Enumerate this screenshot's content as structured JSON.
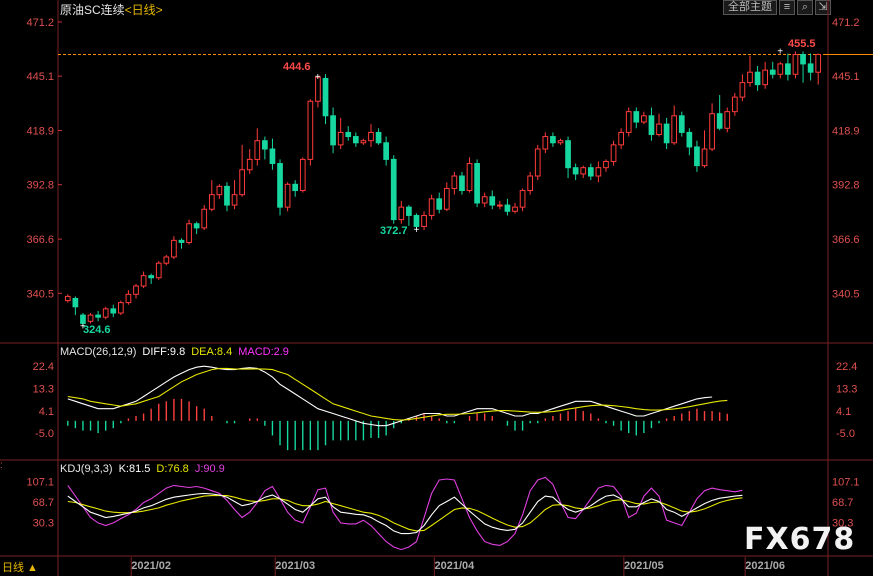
{
  "title": {
    "name": "原油SC连续",
    "period": "<日线>"
  },
  "toolbar": {
    "dropdown_label": "全部主题",
    "icons": [
      "list-icon",
      "search-icon",
      "expand-icon"
    ]
  },
  "colors": {
    "up": "#ff3b3b",
    "down": "#17d7a0",
    "dif": "#ffffff",
    "dea": "#e6e600",
    "macd_label": "#ff33ff",
    "k": "#ffffff",
    "d": "#e6e600",
    "j": "#e040e0",
    "axis": "#c8323c",
    "date_axis": "#aaaaaa"
  },
  "chart_data": [
    {
      "type": "candlestick",
      "title": "原油SC连续",
      "period": "日线",
      "price_ticks": [
        "471.2",
        "445.1",
        "418.9",
        "392.8",
        "366.6",
        "340.5"
      ],
      "ylim": [
        318,
        476
      ],
      "date_ticks": [
        "2021/02",
        "2021/03",
        "2021/04",
        "2021/05",
        "2021/06"
      ],
      "annotations": {
        "high_label": "444.6",
        "low_label": "324.6",
        "mid_low_label": "372.7",
        "last_label": "455.5"
      },
      "last_price": 455.5,
      "candles": [
        [
          337,
          339,
          336,
          340
        ],
        [
          338,
          334,
          330,
          339
        ],
        [
          330,
          326,
          324.6,
          331
        ],
        [
          327,
          330,
          326,
          331
        ],
        [
          330,
          329,
          327,
          332
        ],
        [
          329,
          333,
          328,
          334
        ],
        [
          333,
          331,
          329,
          335
        ],
        [
          331,
          336,
          330,
          337
        ],
        [
          336,
          340,
          335,
          342
        ],
        [
          340,
          344,
          338,
          345
        ],
        [
          344,
          349,
          343,
          351
        ],
        [
          349,
          348,
          345,
          350
        ],
        [
          348,
          355,
          347,
          356
        ],
        [
          355,
          358,
          354,
          359
        ],
        [
          358,
          366,
          357,
          368
        ],
        [
          366,
          365,
          362,
          367
        ],
        [
          365,
          374,
          364,
          376
        ],
        [
          374,
          372,
          369,
          375
        ],
        [
          372,
          381,
          371,
          383
        ],
        [
          381,
          388,
          380,
          395
        ],
        [
          388,
          392,
          386,
          393
        ],
        [
          392,
          383,
          380,
          394
        ],
        [
          383,
          388,
          381,
          395
        ],
        [
          388,
          400,
          387,
          412
        ],
        [
          400,
          405,
          398,
          410
        ],
        [
          405,
          414,
          402,
          420
        ],
        [
          414,
          410,
          405,
          416
        ],
        [
          410,
          403,
          400,
          415
        ],
        [
          403,
          382,
          378,
          405
        ],
        [
          382,
          393,
          380,
          394
        ],
        [
          393,
          390,
          387,
          395
        ],
        [
          390,
          405,
          389,
          406
        ],
        [
          405,
          433,
          402,
          434
        ],
        [
          433,
          444.6,
          430,
          444.6
        ],
        [
          444,
          426,
          422,
          446
        ],
        [
          426,
          412,
          408,
          430
        ],
        [
          412,
          418,
          410,
          425
        ],
        [
          418,
          416,
          414,
          421
        ],
        [
          416,
          413,
          411,
          418
        ],
        [
          413,
          414,
          412,
          415
        ],
        [
          414,
          418,
          411,
          422
        ],
        [
          418,
          413,
          412,
          420
        ],
        [
          413,
          405,
          402,
          416
        ],
        [
          405,
          376,
          374,
          407
        ],
        [
          376,
          382,
          374,
          385
        ],
        [
          382,
          378,
          373,
          383
        ],
        [
          378,
          372.7,
          371,
          379
        ],
        [
          372.7,
          378,
          371,
          380
        ],
        [
          378,
          386,
          376,
          388
        ],
        [
          386,
          381,
          379,
          389
        ],
        [
          381,
          391,
          380,
          394
        ],
        [
          391,
          397,
          388,
          399
        ],
        [
          397,
          390,
          388,
          399
        ],
        [
          390,
          403,
          389,
          406
        ],
        [
          403,
          384,
          382,
          405
        ],
        [
          384,
          387,
          382,
          389
        ],
        [
          387,
          383,
          381,
          390
        ],
        [
          383,
          383,
          381,
          385
        ],
        [
          383,
          380,
          378,
          386
        ],
        [
          380,
          382,
          379,
          384
        ],
        [
          382,
          390,
          380,
          391
        ],
        [
          390,
          397,
          388,
          399
        ],
        [
          397,
          410,
          395,
          412
        ],
        [
          410,
          416,
          408,
          418
        ],
        [
          416,
          413,
          411,
          418
        ],
        [
          413,
          414,
          412,
          415
        ],
        [
          414,
          401,
          396,
          416
        ],
        [
          401,
          398,
          395,
          403
        ],
        [
          398,
          401,
          396,
          402
        ],
        [
          401,
          397,
          395,
          403
        ],
        [
          397,
          401,
          394,
          404
        ],
        [
          401,
          404,
          399,
          405
        ],
        [
          404,
          412,
          402,
          414
        ],
        [
          412,
          418,
          410,
          420
        ],
        [
          418,
          428,
          416,
          430
        ],
        [
          428,
          423,
          420,
          430
        ],
        [
          423,
          426,
          422,
          428
        ],
        [
          426,
          417,
          414,
          430
        ],
        [
          417,
          422,
          416,
          427
        ],
        [
          422,
          413,
          410,
          425
        ],
        [
          413,
          426,
          412,
          431
        ],
        [
          426,
          418,
          416,
          428
        ],
        [
          418,
          411,
          407,
          420
        ],
        [
          411,
          402,
          399,
          414
        ],
        [
          402,
          410,
          401,
          419
        ],
        [
          410,
          427,
          409,
          432
        ],
        [
          427,
          420,
          419,
          436
        ],
        [
          420,
          428,
          418,
          430
        ],
        [
          428,
          435,
          426,
          437
        ],
        [
          435,
          442,
          433,
          446
        ],
        [
          442,
          447,
          440,
          455
        ],
        [
          447,
          441,
          438,
          450
        ],
        [
          441,
          448,
          439,
          452
        ],
        [
          448,
          446,
          444,
          452
        ],
        [
          446,
          451,
          444,
          452
        ],
        [
          451,
          446,
          443,
          456
        ],
        [
          446,
          455.5,
          444,
          457
        ],
        [
          455.5,
          451,
          442,
          457
        ],
        [
          451,
          447,
          443,
          456
        ],
        [
          447,
          455.5,
          441,
          456
        ]
      ]
    },
    {
      "type": "macd",
      "label": "MACD(26,12,9)",
      "diff_label": "DIFF:9.8",
      "dea_label": "DEA:8.4",
      "macd_label": "MACD:2.9",
      "ticks": [
        "22.4",
        "13.3",
        "4.1",
        "-5.0"
      ],
      "ylim": [
        -14,
        27
      ],
      "diff": [
        9,
        8,
        7,
        6,
        5,
        5,
        5,
        6,
        7,
        8,
        10,
        12,
        14,
        16,
        18,
        19.5,
        21,
        22,
        22.4,
        22,
        21.4,
        21,
        21,
        21.5,
        21.8,
        21.5,
        20,
        18,
        15,
        13,
        11,
        9,
        7,
        5,
        4,
        3,
        2,
        1,
        0,
        -1,
        -1.5,
        -2,
        -2,
        -1,
        0,
        1,
        2,
        3,
        3,
        3,
        2,
        2,
        3,
        4,
        5,
        5,
        5,
        4,
        3,
        2,
        2,
        3,
        3,
        4,
        5,
        6,
        7,
        8,
        8,
        8,
        7,
        6,
        5,
        4,
        3,
        2,
        2,
        3,
        4,
        5,
        6,
        7,
        8,
        9,
        9.5,
        9.8
      ],
      "dea": [
        10,
        9.5,
        9,
        8,
        7.5,
        7,
        6.5,
        6,
        6.5,
        7,
        8,
        9,
        10,
        12,
        14,
        16,
        17.5,
        19,
        20,
        21,
        21.5,
        21.5,
        21.3,
        21.2,
        21.2,
        21.3,
        21.2,
        21,
        20,
        19,
        17,
        15,
        13,
        11,
        9,
        7,
        6,
        5,
        4,
        3,
        2,
        1.5,
        1,
        0.5,
        0.3,
        0.5,
        1,
        1.5,
        2,
        2.5,
        2.7,
        2.7,
        2.8,
        3,
        3.3,
        3.7,
        4,
        4.2,
        4.2,
        4,
        3.8,
        3.6,
        3.5,
        3.6,
        3.8,
        4.2,
        4.8,
        5.3,
        5.8,
        6.2,
        6.4,
        6.4,
        6.2,
        5.9,
        5.5,
        5,
        4.6,
        4.4,
        4.4,
        4.6,
        4.9,
        5.3,
        5.8,
        6.4,
        7,
        7.6,
        8.1,
        8.4
      ],
      "hist": [
        -2,
        -3,
        -4,
        -4,
        -5,
        -4,
        -3,
        -1,
        1,
        2,
        3,
        5,
        7,
        8,
        9,
        9,
        8,
        6,
        5,
        2,
        0,
        -1,
        -1,
        0,
        1,
        1,
        -2,
        -6,
        -10,
        -12,
        -12,
        -12,
        -12,
        -12,
        -10,
        -8,
        -8,
        -8,
        -8,
        -8,
        -7,
        -7,
        -6,
        -3,
        -1,
        1,
        2,
        3,
        2,
        1,
        -1,
        -1,
        0,
        2,
        3,
        3,
        2,
        0,
        -2,
        -4,
        -4,
        -1,
        -1,
        1,
        2,
        3,
        4,
        5,
        4,
        3,
        1,
        -1,
        -2,
        -4,
        -5,
        -6,
        -5,
        -3,
        -1,
        1,
        2,
        3,
        4,
        5,
        4,
        4,
        3.5,
        2.9
      ]
    },
    {
      "type": "kdj",
      "label": "KDJ(9,3,3)",
      "k_label": "K:81.5",
      "d_label": "D:76.8",
      "j_label": "J:90.9",
      "ticks": [
        "107.1",
        "68.7",
        "30.3"
      ],
      "ylim": [
        -30,
        125
      ],
      "k": [
        80,
        70,
        60,
        50,
        45,
        40,
        42,
        45,
        48,
        52,
        58,
        62,
        68,
        74,
        78,
        80,
        82,
        84,
        85,
        84,
        82,
        78,
        70,
        62,
        65,
        70,
        78,
        82,
        75,
        65,
        55,
        50,
        62,
        75,
        78,
        60,
        50,
        48,
        46,
        45,
        40,
        32,
        25,
        15,
        10,
        10,
        12,
        25,
        45,
        62,
        70,
        78,
        65,
        52,
        40,
        28,
        22,
        18,
        16,
        18,
        30,
        50,
        70,
        80,
        78,
        65,
        55,
        50,
        55,
        62,
        72,
        80,
        82,
        75,
        60,
        60,
        68,
        75,
        70,
        55,
        50,
        42,
        50,
        58,
        66,
        72,
        76,
        78,
        80,
        81.5
      ],
      "d": [
        70,
        68,
        64,
        60,
        56,
        52,
        50,
        49,
        49,
        50,
        52,
        55,
        58,
        63,
        67,
        71,
        74,
        77,
        80,
        81,
        81,
        81,
        78,
        74,
        71,
        70,
        72,
        75,
        75,
        72,
        66,
        62,
        62,
        65,
        70,
        66,
        62,
        58,
        54,
        50,
        48,
        44,
        38,
        30,
        24,
        18,
        15,
        16,
        25,
        35,
        45,
        55,
        58,
        57,
        53,
        46,
        39,
        32,
        26,
        22,
        23,
        30,
        42,
        55,
        63,
        64,
        62,
        58,
        56,
        58,
        62,
        68,
        72,
        73,
        70,
        66,
        65,
        68,
        69,
        64,
        58,
        52,
        50,
        52,
        56,
        62,
        68,
        72,
        75,
        76.8
      ],
      "j": [
        100,
        80,
        60,
        40,
        30,
        25,
        30,
        38,
        45,
        55,
        68,
        75,
        85,
        95,
        100,
        98,
        96,
        98,
        95,
        90,
        85,
        72,
        55,
        40,
        50,
        68,
        90,
        98,
        75,
        50,
        35,
        30,
        60,
        92,
        95,
        50,
        30,
        28,
        28,
        35,
        25,
        10,
        -5,
        -15,
        -20,
        -15,
        -5,
        40,
        85,
        110,
        112,
        110,
        75,
        40,
        15,
        -5,
        -10,
        -12,
        -5,
        10,
        45,
        90,
        110,
        115,
        102,
        68,
        40,
        38,
        55,
        75,
        95,
        100,
        98,
        80,
        40,
        48,
        80,
        95,
        80,
        35,
        30,
        25,
        50,
        75,
        90,
        95,
        92,
        90,
        88,
        90.9
      ]
    }
  ],
  "footer": {
    "period_button": "日线 ▲",
    "watermark": "FX678"
  }
}
